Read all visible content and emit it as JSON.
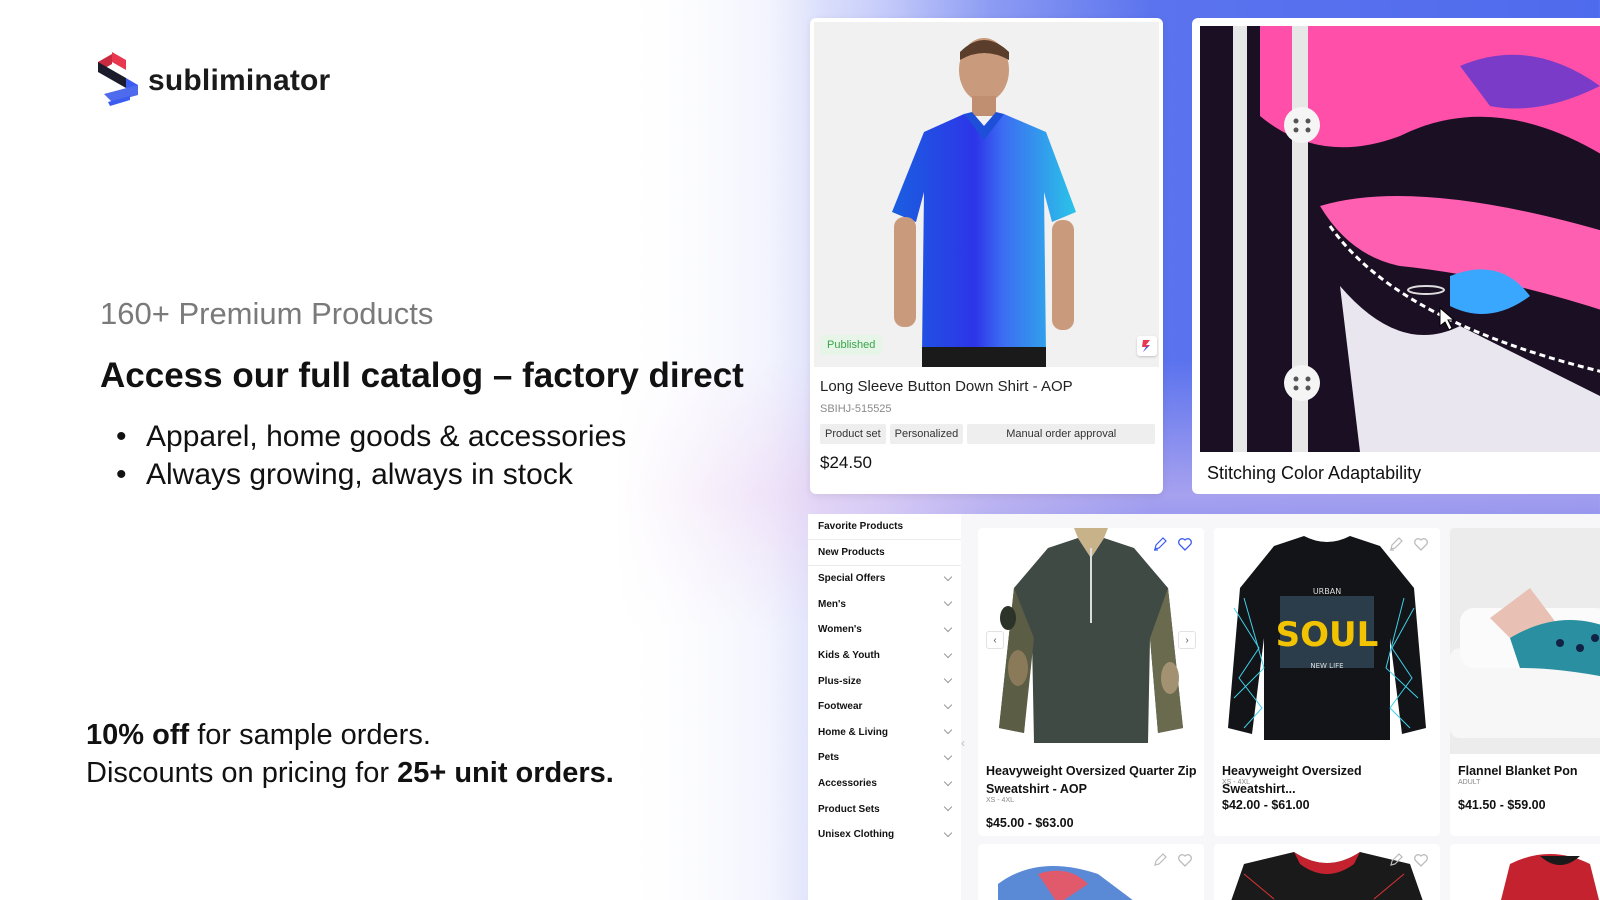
{
  "brand": {
    "name": "subliminator"
  },
  "hero": {
    "eyebrow": "160+ Premium Products",
    "headline": "Access our full catalog – factory direct",
    "bullets": [
      "Apparel, home goods & accessories",
      "Always growing, always in stock"
    ],
    "promo_line1_bold": "10% off",
    "promo_line1_rest": " for sample orders.",
    "promo_line2_rest": "Discounts on pricing for ",
    "promo_line2_bold": "25+ unit orders."
  },
  "featured_product": {
    "status": "Published",
    "title": "Long Sleeve Button Down Shirt - AOP",
    "sku": "SBIHJ-515525",
    "tags": [
      "Product set",
      "Personalized",
      "Manual order approval"
    ],
    "price": "$24.50"
  },
  "feature_card": {
    "title": "Stitching Color Adaptability"
  },
  "catalog": {
    "sidebar": [
      {
        "label": "Favorite Products",
        "expandable": false
      },
      {
        "label": "New Products",
        "expandable": false
      },
      {
        "label": "Special Offers",
        "expandable": true
      },
      {
        "label": "Men's",
        "expandable": true
      },
      {
        "label": "Women's",
        "expandable": true
      },
      {
        "label": "Kids & Youth",
        "expandable": true
      },
      {
        "label": "Plus-size",
        "expandable": true
      },
      {
        "label": "Footwear",
        "expandable": true
      },
      {
        "label": "Home & Living",
        "expandable": true
      },
      {
        "label": "Pets",
        "expandable": true
      },
      {
        "label": "Accessories",
        "expandable": true
      },
      {
        "label": "Product Sets",
        "expandable": true
      },
      {
        "label": "Unisex Clothing",
        "expandable": true
      }
    ],
    "products": [
      {
        "name": "Heavyweight Oversized Quarter Zip Sweatshirt - AOP",
        "sizes": "XS - 4XL",
        "price": "$45.00 - $63.00"
      },
      {
        "name": "Heavyweight Oversized Sweatshirt...",
        "sizes": "XS - 4XL",
        "price": "$42.00 - $61.00",
        "print_text_1": "URBAN",
        "print_text_2": "SOUL",
        "print_text_3": "NEW LIFE"
      },
      {
        "name": "Flannel Blanket Pon",
        "sizes": "ADULT",
        "price": "$41.50 - $59.00"
      }
    ],
    "prev_arrow": "‹",
    "next_arrow": "›"
  },
  "colors": {
    "accent_blue": "#4f6bed",
    "published_green": "#3aa44a",
    "brand_red": "#e8384f",
    "brand_blue": "#3b5cf0"
  }
}
